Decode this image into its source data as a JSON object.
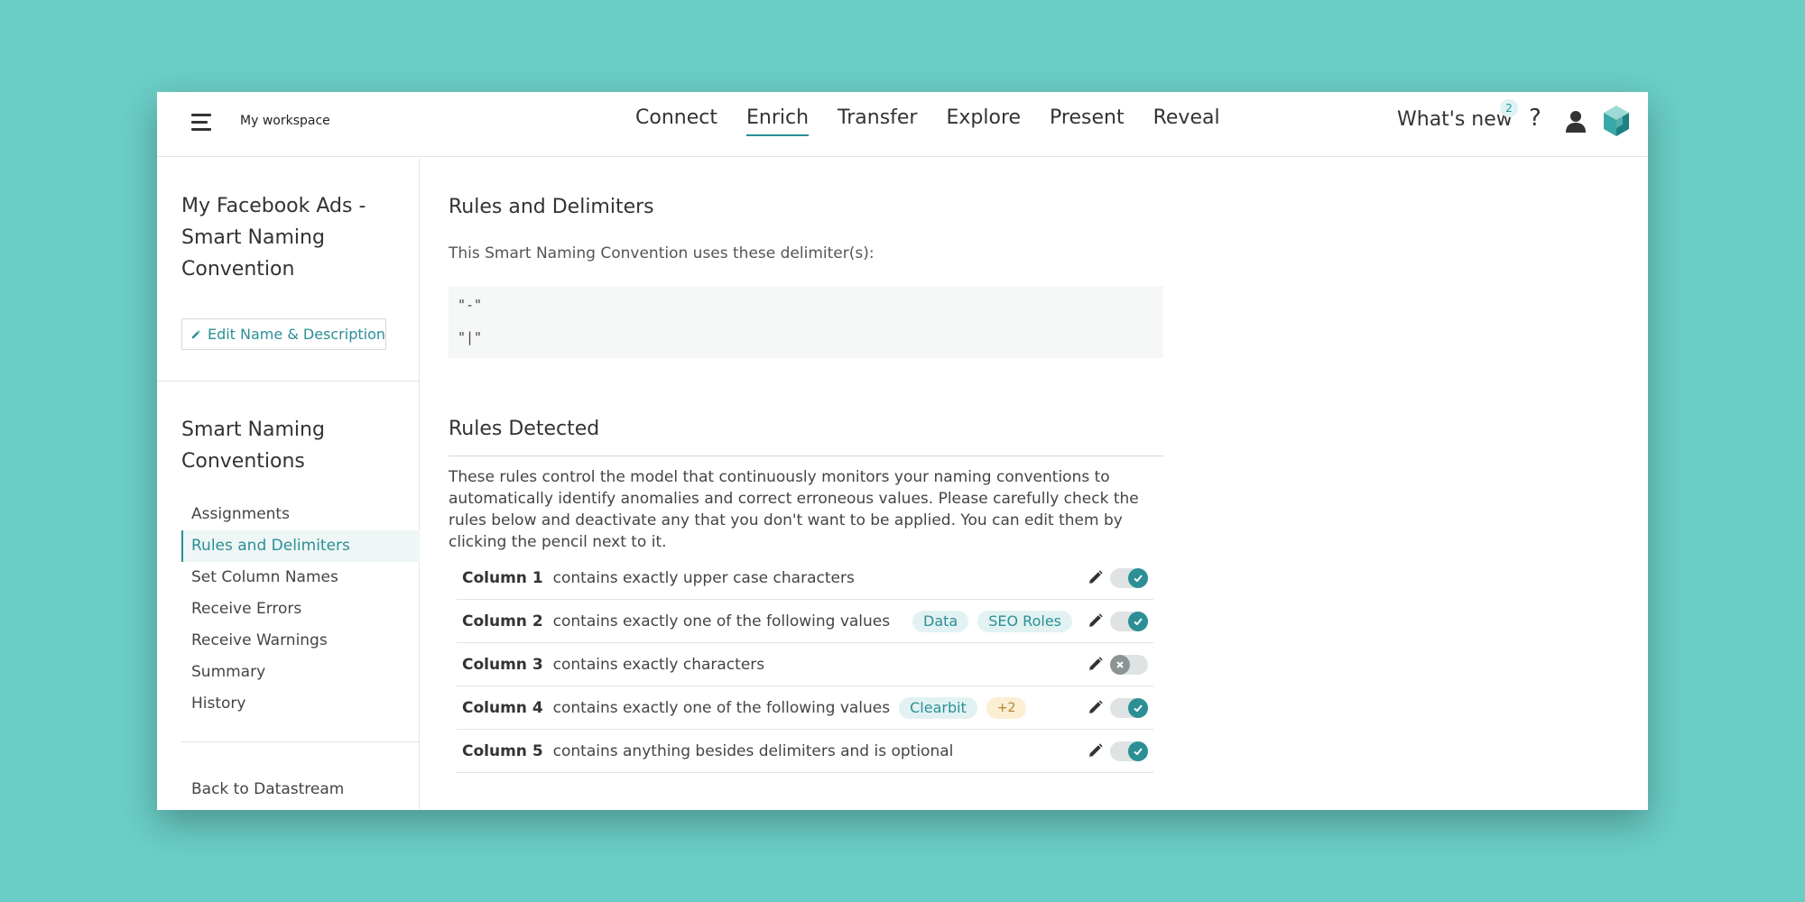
{
  "header": {
    "workspace": "My workspace",
    "nav": [
      "Connect",
      "Enrich",
      "Transfer",
      "Explore",
      "Present",
      "Reveal"
    ],
    "active_nav": "Enrich",
    "whats_new_label": "What's new",
    "whats_new_count": "2",
    "help_label": "?"
  },
  "sidebar": {
    "title": "My Facebook Ads - Smart Naming Convention",
    "edit_label": "Edit Name & Description",
    "section_title": "Smart Naming Conventions",
    "items": [
      {
        "label": "Assignments",
        "active": false
      },
      {
        "label": "Rules and Delimiters",
        "active": true
      },
      {
        "label": "Set Column Names",
        "active": false
      },
      {
        "label": "Receive Errors",
        "active": false
      },
      {
        "label": "Receive Warnings",
        "active": false
      },
      {
        "label": "Summary",
        "active": false
      },
      {
        "label": "History",
        "active": false
      }
    ],
    "back_label": "Back to Datastream"
  },
  "main": {
    "section1_title": "Rules and Delimiters",
    "delimiter_intro": "This Smart Naming Convention uses these delimiter(s):",
    "delimiters": [
      "\"-\"",
      "\"|\""
    ],
    "section2_title": "Rules Detected",
    "rules_description": "These rules control the model that continuously monitors your naming conventions to automatically identify anomalies and correct erroneous values. Please carefully check the rules below and deactivate any that you don't want to be applied. You can edit them by clicking the pencil next to it.",
    "rules": [
      {
        "column": "Column 1",
        "text": "contains exactly upper case characters",
        "inline_tags": [],
        "right_tags": [],
        "more": "",
        "enabled": true
      },
      {
        "column": "Column 2",
        "text": "contains exactly one of the following values",
        "inline_tags": [],
        "right_tags": [
          "Data",
          "SEO Roles"
        ],
        "more": "",
        "enabled": true
      },
      {
        "column": "Column 3",
        "text": "contains exactly characters",
        "inline_tags": [],
        "right_tags": [],
        "more": "",
        "enabled": false
      },
      {
        "column": "Column 4",
        "text": "contains exactly one of the following values",
        "inline_tags": [
          "Clearbit"
        ],
        "right_tags": [],
        "more": "+2",
        "enabled": true
      },
      {
        "column": "Column 5",
        "text": "contains anything besides delimiters and is optional",
        "inline_tags": [],
        "right_tags": [],
        "more": "",
        "enabled": true
      }
    ]
  },
  "colors": {
    "background": "#6acdc6",
    "accent": "#2b8f95",
    "tag_bg": "#e2f2f2",
    "more_tag_bg": "#fbeed3",
    "toggle_off_knob": "#8c9494"
  }
}
